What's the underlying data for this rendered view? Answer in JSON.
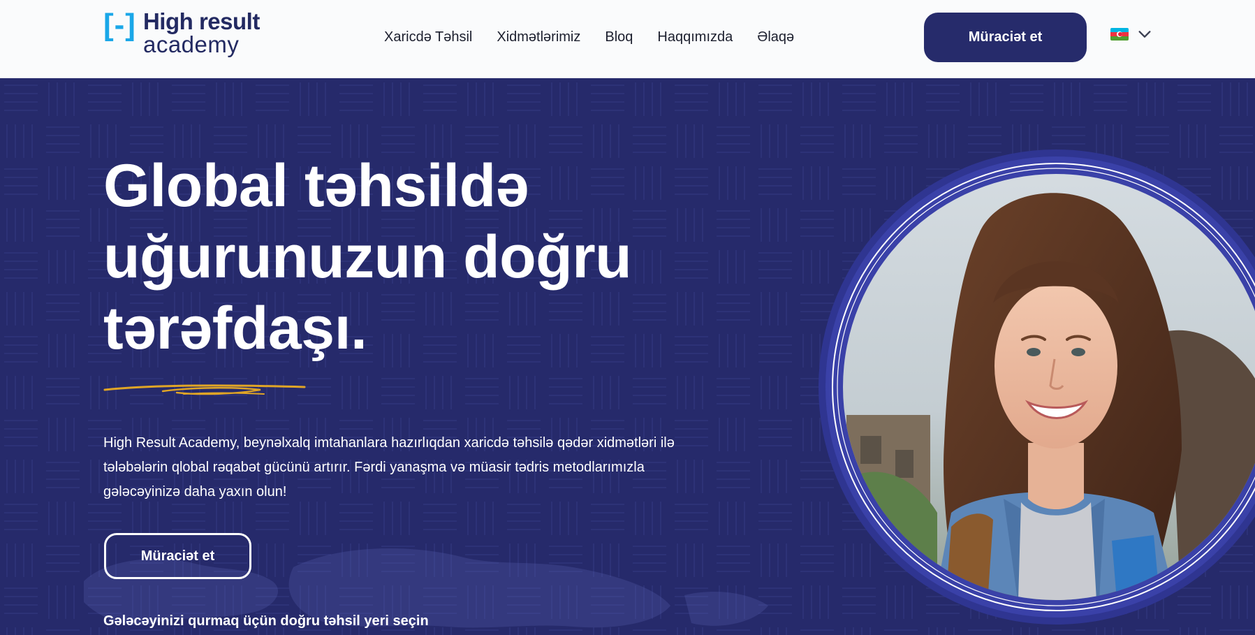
{
  "header": {
    "logo": {
      "bracket": "[-]",
      "line1": "High result",
      "line2": "academy"
    },
    "nav": [
      {
        "label": "Xaricdə Təhsil"
      },
      {
        "label": "Xidmətlərimiz"
      },
      {
        "label": "Bloq"
      },
      {
        "label": "Haqqımızda"
      },
      {
        "label": "Əlaqə"
      }
    ],
    "cta_label": "Müraciət et",
    "language": {
      "flag": "azerbaijan-flag-icon",
      "icon": "chevron-down-icon"
    }
  },
  "hero": {
    "title_lines": [
      "Global təhsildə",
      "uğurunuzun doğru",
      "tərəfdaşı."
    ],
    "description": "High Result Academy, beynəlxalq imtahanlara hazırlıqdan xaricdə təhsilə qədər xidmətləri ilə tələbələrin qlobal rəqabət gücünü artırır. Fərdi yanaşma və müasir tədris metodlarımızla gələcəyinizə daha yaxın olun!",
    "cta_label": "Müraciət et",
    "subheading": "Gələcəyinizi qurmaq üçün doğru təhsil yeri seçin",
    "portrait": "smiling-student-photo"
  },
  "colors": {
    "navy": "#262a6b",
    "accent_blue": "#1aa7e8",
    "gold": "#e0a526",
    "circle_ring": "#3a41a8"
  }
}
